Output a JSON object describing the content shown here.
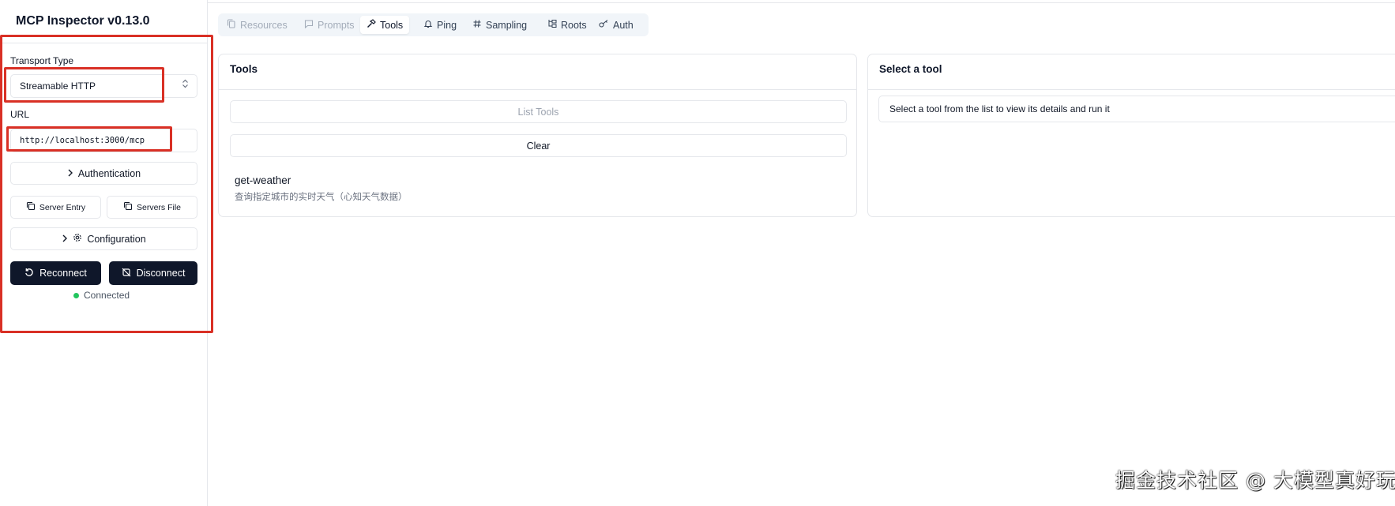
{
  "app": {
    "title": "MCP Inspector v0.13.0"
  },
  "sidebar": {
    "transport_label": "Transport Type",
    "transport_value": "Streamable HTTP",
    "url_label": "URL",
    "url_value": "http://localhost:3000/mcp",
    "authentication_label": "Authentication",
    "server_entry_label": "Server Entry",
    "servers_file_label": "Servers File",
    "configuration_label": "Configuration",
    "reconnect_label": "Reconnect",
    "disconnect_label": "Disconnect",
    "status_text": "Connected"
  },
  "tabs": [
    {
      "label": "Resources",
      "icon": "files-icon",
      "disabled": true
    },
    {
      "label": "Prompts",
      "icon": "message-icon",
      "disabled": true
    },
    {
      "label": "Tools",
      "icon": "hammer-icon",
      "active": true
    },
    {
      "label": "Ping",
      "icon": "bell-icon"
    },
    {
      "label": "Sampling",
      "icon": "hash-icon"
    },
    {
      "label": "Roots",
      "icon": "folder-tree-icon"
    },
    {
      "label": "Auth",
      "icon": "key-icon"
    }
  ],
  "tools_panel": {
    "title": "Tools",
    "list_tools_label": "List Tools",
    "clear_label": "Clear",
    "tools": [
      {
        "name": "get-weather",
        "description": "查询指定城市的实时天气（心知天气数据）"
      }
    ]
  },
  "detail_panel": {
    "title": "Select a tool",
    "hint": "Select a tool from the list to view its details and run it"
  },
  "watermark": "掘金技术社区 @ 大模型真好玩",
  "colors": {
    "primary_dark": "#0f172a",
    "status_connected": "#22c55e",
    "highlight_red": "#d93025",
    "border": "#e5e7eb"
  }
}
